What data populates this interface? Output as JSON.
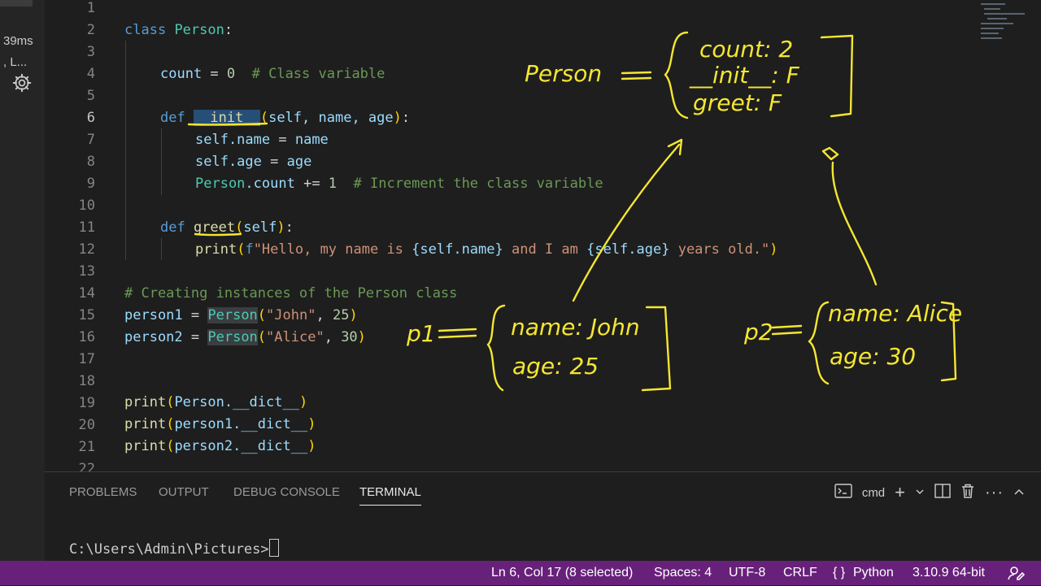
{
  "left_meta": {
    "timing": "39ms",
    "line2": ", L..."
  },
  "editor": {
    "current_line": 6,
    "lines": [
      {
        "n": "1"
      },
      {
        "n": "2"
      },
      {
        "n": "3"
      },
      {
        "n": "4"
      },
      {
        "n": "5"
      },
      {
        "n": "6"
      },
      {
        "n": "7"
      },
      {
        "n": "8"
      },
      {
        "n": "9"
      },
      {
        "n": "10"
      },
      {
        "n": "11"
      },
      {
        "n": "12"
      },
      {
        "n": "13"
      },
      {
        "n": "14"
      },
      {
        "n": "15"
      },
      {
        "n": "16"
      },
      {
        "n": "17"
      },
      {
        "n": "18"
      },
      {
        "n": "19"
      },
      {
        "n": "20"
      },
      {
        "n": "21"
      },
      {
        "n": "22"
      }
    ],
    "tokens": {
      "l2_kw": "class",
      "l2_cls": "Person",
      "l2_p": ":",
      "l4_var": "count",
      "l4_op": " = ",
      "l4_num": "0",
      "l4_cm": "  # Class variable",
      "l6_kw": "def ",
      "l6_fn": "__init__",
      "l6_b1": "(",
      "l6_args": "self, name, age",
      "l6_b2": ")",
      "l6_p": ":",
      "l7_var": "self.name",
      "l7_op": " = ",
      "l7_val": "name",
      "l8_var": "self.age",
      "l8_op": " = ",
      "l8_val": "age",
      "l9_cls": "Person",
      "l9_var": ".count",
      "l9_op": " += ",
      "l9_num": "1",
      "l9_cm": "  # Increment the class variable",
      "l11_kw": "def ",
      "l11_fn": "greet",
      "l11_b1": "(",
      "l11_args": "self",
      "l11_b2": ")",
      "l11_p": ":",
      "l12_fn": "print",
      "l12_b1": "(",
      "l12_f": "f",
      "l12_s1": "\"Hello, my name is ",
      "l12_e1": "{self.name}",
      "l12_s2": " and I am ",
      "l12_e2": "{self.age}",
      "l12_s3": " years old.\"",
      "l12_b2": ")",
      "l14_cm": "# Creating instances of the Person class",
      "l15_var": "person1",
      "l15_op": " = ",
      "l15_cls": "Person",
      "l15_b1": "(",
      "l15_str": "\"John\"",
      "l15_c": ", ",
      "l15_num": "25",
      "l15_b2": ")",
      "l16_var": "person2",
      "l16_op": " = ",
      "l16_cls": "Person",
      "l16_b1": "(",
      "l16_str": "\"Alice\"",
      "l16_c": ", ",
      "l16_num": "30",
      "l16_b2": ")",
      "l19_fn": "print",
      "l19_b1": "(",
      "l19_arg": "Person.__dict__",
      "l19_b2": ")",
      "l20_fn": "print",
      "l20_b1": "(",
      "l20_arg": "person1.__dict__",
      "l20_b2": ")",
      "l21_fn": "print",
      "l21_b1": "(",
      "l21_arg": "person2.__dict__",
      "l21_b2": ")"
    }
  },
  "panel": {
    "tabs": [
      "PROBLEMS",
      "OUTPUT",
      "DEBUG CONSOLE",
      "TERMINAL"
    ],
    "active_tab": "TERMINAL",
    "shell": "cmd",
    "prompt": "C:\\Users\\Admin\\Pictures>"
  },
  "status": {
    "position": "Ln 6, Col 17 (8 selected)",
    "spaces": "Spaces: 4",
    "encoding": "UTF-8",
    "eol": "CRLF",
    "language": "Python",
    "interpreter": "3.10.9 64-bit",
    "background_color": "#68217a"
  },
  "annotations": {
    "ink_color": "#f5e632",
    "person_label": "Person",
    "person_items": [
      "count: 2",
      "__init__: F",
      "greet: F"
    ],
    "p1_label": "p1",
    "p1_items": [
      "name: John",
      "age: 25"
    ],
    "p2_label": "p2",
    "p2_items": [
      "name: Alice",
      "age: 30"
    ]
  },
  "icons": {
    "gear": "gear-icon",
    "terminal_profile": "terminal-icon",
    "add": "plus-icon",
    "dropdown": "chevron-down-icon",
    "split": "split-icon",
    "trash": "trash-icon",
    "more": "ellipsis-icon",
    "maximize": "chevron-up-icon",
    "language": "braces-icon",
    "feedback": "feedback-icon"
  }
}
